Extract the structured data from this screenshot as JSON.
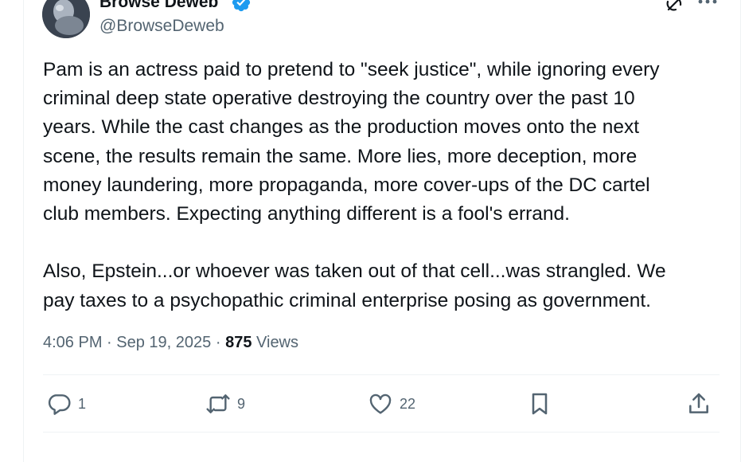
{
  "author": {
    "display_name": "Browse Deweb",
    "handle": "@BrowseDeweb"
  },
  "tweet": {
    "text": "Pam is an actress paid to pretend to \"seek justice\", while ignoring every\ncriminal deep state operative destroying the country over the past 10\nyears. While the cast changes as the production moves onto the next\nscene, the results remain the same. More lies, more deception, more\nmoney laundering, more propaganda, more cover-ups of the DC cartel\nclub members. Expecting anything different is a fool's errand.\n\nAlso, Epstein...or whoever was taken out of that cell...was strangled. We\npay taxes to a psychopathic criminal enterprise posing as government.",
    "time": "4:06 PM",
    "separator": "·",
    "date": "Sep 19, 2025",
    "views_count": "875",
    "views_label": "Views"
  },
  "actions": {
    "replies": "1",
    "reposts": "9",
    "likes": "22"
  },
  "colors": {
    "verified": "#1d9bf0",
    "text": "#0f1419",
    "secondary": "#536471",
    "divider": "#eff3f4"
  },
  "icons": [
    "verified-badge-icon",
    "grok-icon",
    "more-icon",
    "reply-icon",
    "repost-icon",
    "like-icon",
    "bookmark-icon",
    "share-icon"
  ]
}
